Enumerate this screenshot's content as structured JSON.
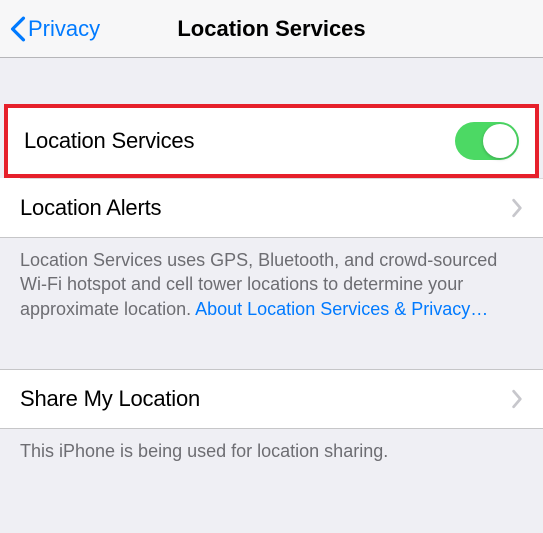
{
  "nav": {
    "back_label": "Privacy",
    "title": "Location Services"
  },
  "rows": {
    "location_services": "Location Services",
    "location_alerts": "Location Alerts",
    "share_my_location": "Share My Location"
  },
  "footers": {
    "services_desc": "Location Services uses GPS, Bluetooth, and crowd-sourced Wi-Fi hotspot and cell tower locations to determine your approximate location. ",
    "services_link": "About Location Services & Privacy…",
    "share_desc": "This iPhone is being used for location sharing."
  },
  "toggle": {
    "location_services_on": true
  },
  "colors": {
    "accent": "#007aff",
    "toggle_on": "#4cd964",
    "highlight": "#e6202b"
  }
}
